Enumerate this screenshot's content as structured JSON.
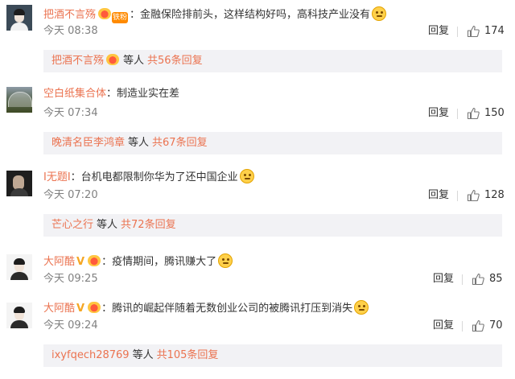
{
  "comments": [
    {
      "username": "把酒不言殇",
      "vip_label": "铁粉",
      "text": "：金融保险排前头，这样结构好吗，高科技产业没有",
      "time": "今天 08:38",
      "reply_label": "回复",
      "likes": "174",
      "sub": {
        "name": "把酒不言殇",
        "deng": "等人",
        "count": "共56条回复"
      }
    },
    {
      "username": "空白纸集合体",
      "text": "：制造业实在差",
      "time": "今天 07:34",
      "reply_label": "回复",
      "likes": "150",
      "sub": {
        "name": "晚清名臣李鸿章",
        "deng": "等人",
        "count": "共67条回复"
      }
    },
    {
      "username": "I无题I",
      "text": "：台机电都限制你华为了还中国企业",
      "time": "今天 07:20",
      "reply_label": "回复",
      "likes": "128",
      "sub": {
        "name": "芒心之行",
        "deng": "等人",
        "count": "共72条回复"
      }
    },
    {
      "username": "大阿酷",
      "text": "：疫情期间，腾讯赚大了",
      "time": "今天 09:25",
      "reply_label": "回复",
      "likes": "85"
    },
    {
      "username": "大阿酷",
      "text": "：腾讯的崛起伴随着无数创业公司的被腾讯打压到消失",
      "time": "今天 09:24",
      "reply_label": "回复",
      "likes": "70",
      "sub": {
        "name": "ixyfqech28769",
        "deng": "等人",
        "count": "共105条回复"
      }
    }
  ],
  "colors": {
    "username": "#eb7350",
    "subpanel_bg": "#f2f2f5",
    "meta": "#808080"
  },
  "icons": {
    "like": "thumbs-up-icon",
    "emoji": "smiley-emoji-icon",
    "badge": "fan-badge-icon",
    "verified": "verified-v-icon"
  }
}
